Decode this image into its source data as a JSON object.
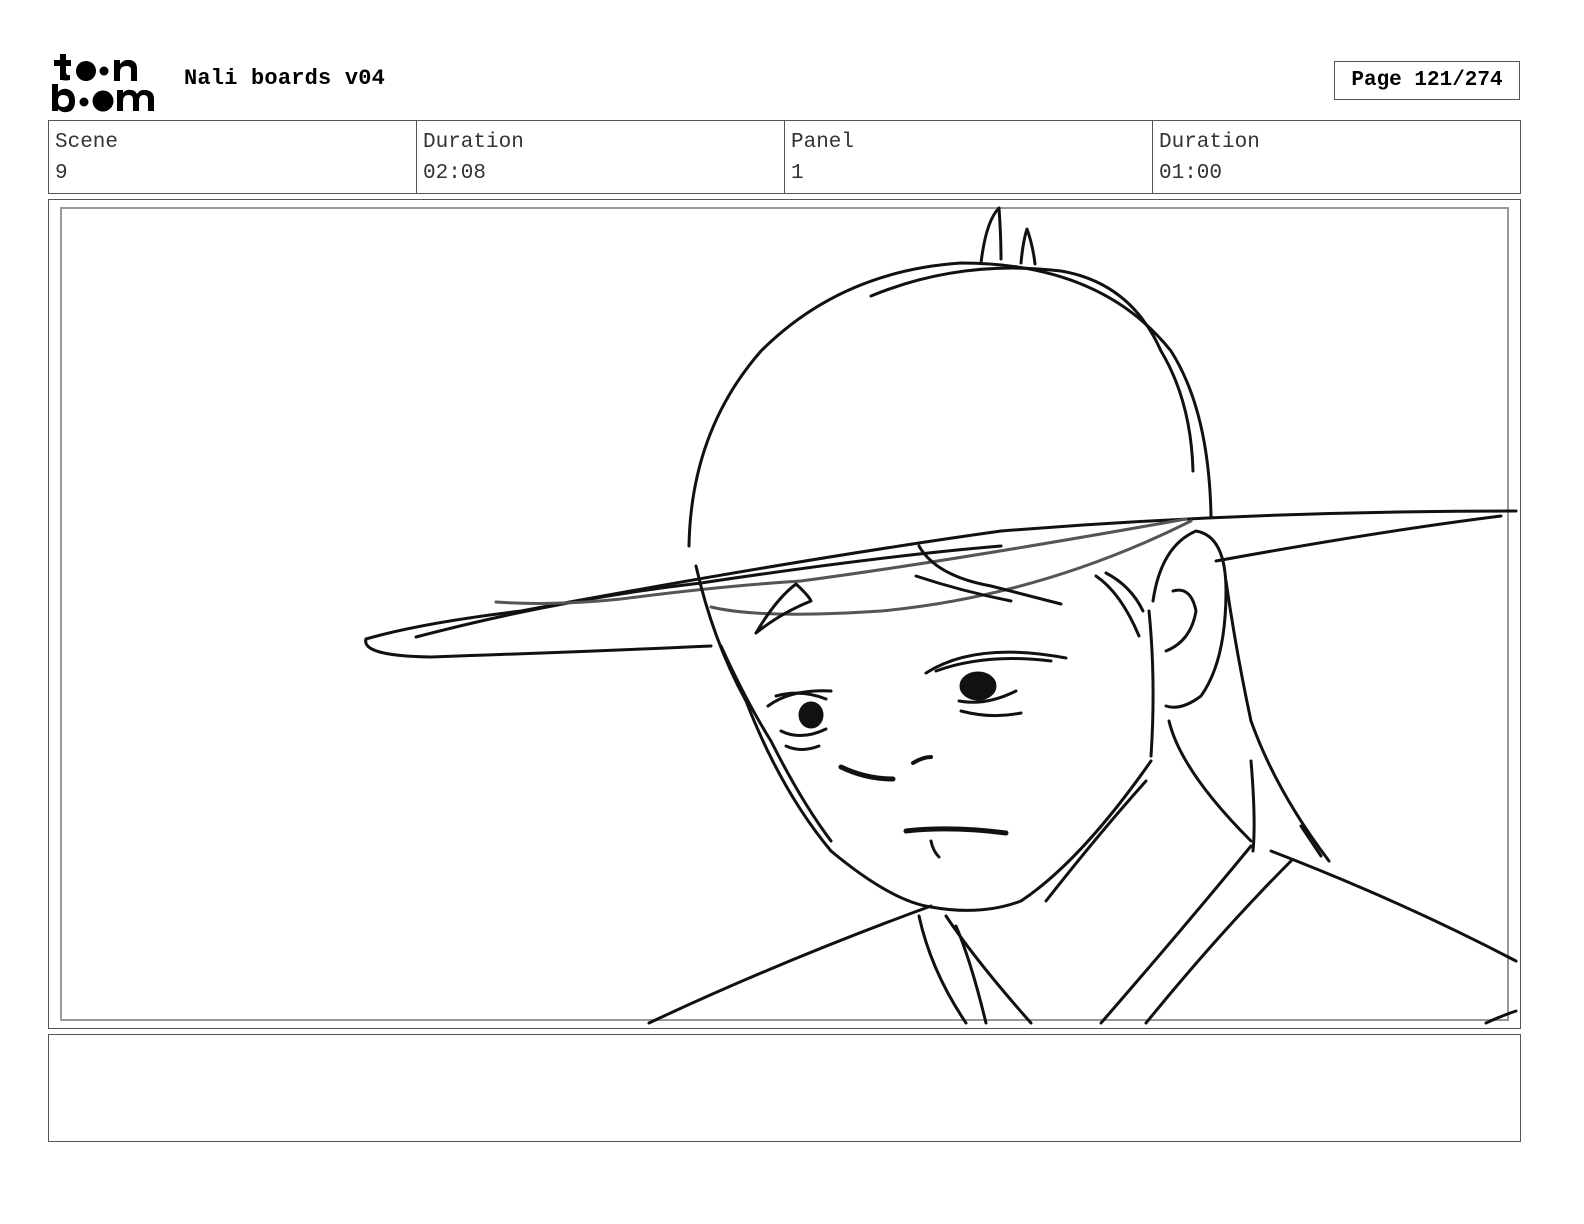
{
  "header": {
    "logo_alt": "toon boom",
    "title": "Nali boards v04",
    "page_label": "Page 121/274"
  },
  "info": {
    "scene_label": "Scene",
    "scene_value": "9",
    "scene_duration_label": "Duration",
    "scene_duration_value": "02:08",
    "panel_label": "Panel",
    "panel_value": "1",
    "panel_duration_label": "Duration",
    "panel_duration_value": "01:00"
  },
  "panel": {
    "image_icon": "sketch-image"
  },
  "notes": {
    "text": ""
  }
}
